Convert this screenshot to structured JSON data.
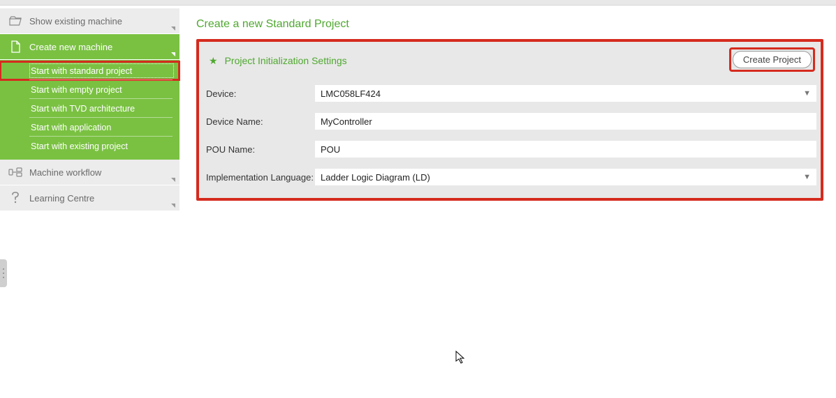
{
  "sidebar": {
    "items": [
      {
        "label": "Show existing machine",
        "active": false
      },
      {
        "label": "Create new machine",
        "active": true
      },
      {
        "label": "Machine workflow",
        "active": false
      },
      {
        "label": "Learning Centre",
        "active": false
      }
    ],
    "sub_items": [
      {
        "label": "Start with standard project",
        "highlight": true
      },
      {
        "label": "Start with empty project",
        "highlight": false
      },
      {
        "label": "Start with TVD architecture",
        "highlight": false
      },
      {
        "label": "Start with application",
        "highlight": false
      },
      {
        "label": "Start with existing project",
        "highlight": false
      }
    ]
  },
  "main": {
    "title": "Create a new Standard Project",
    "section_title": "Project Initialization Settings",
    "create_button": "Create Project",
    "fields": {
      "device": {
        "label": "Device:",
        "value": "LMC058LF424"
      },
      "device_name": {
        "label": "Device Name:",
        "value": "MyController"
      },
      "pou_name": {
        "label": "POU Name:",
        "value": "POU"
      },
      "impl_lang": {
        "label": "Implementation Language:",
        "value": "Ladder Logic Diagram (LD)"
      }
    }
  }
}
